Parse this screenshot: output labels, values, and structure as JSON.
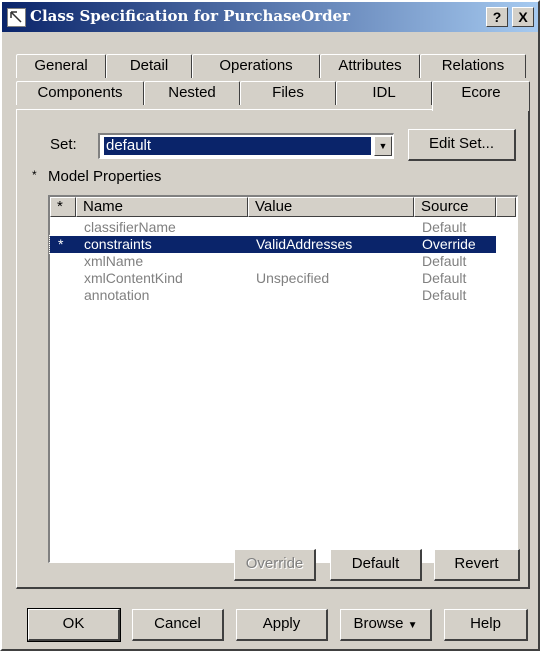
{
  "window": {
    "title": "Class Specification for PurchaseOrder",
    "help_btn": "?",
    "close_btn": "X"
  },
  "tabs": {
    "row_back": [
      "General",
      "Detail",
      "Operations",
      "Attributes",
      "Relations"
    ],
    "row_front": [
      "Components",
      "Nested",
      "Files",
      "IDL",
      "Ecore"
    ],
    "active": "Ecore"
  },
  "set": {
    "label": "Set:",
    "value": "default",
    "edit_button": "Edit Set..."
  },
  "model_properties": {
    "marker": "*",
    "label": "Model Properties",
    "columns": {
      "marker": "*",
      "name": "Name",
      "value": "Value",
      "source": "Source"
    },
    "rows": [
      {
        "marker": "",
        "name": "classifierName",
        "value": "",
        "source": "Default"
      },
      {
        "marker": "*",
        "name": "constraints",
        "value": "ValidAddresses",
        "source": "Override"
      },
      {
        "marker": "",
        "name": "xmlName",
        "value": "",
        "source": "Default"
      },
      {
        "marker": "",
        "name": "xmlContentKind",
        "value": "Unspecified",
        "source": "Default"
      },
      {
        "marker": "",
        "name": "annotation",
        "value": "",
        "source": "Default"
      }
    ]
  },
  "panel_buttons": {
    "override": "Override",
    "default": "Default",
    "revert": "Revert"
  },
  "footer": {
    "ok": "OK",
    "cancel": "Cancel",
    "apply": "Apply",
    "browse": "Browse",
    "help": "Help"
  },
  "colors": {
    "selection": "#0a246a",
    "face": "#d4d0c8",
    "title_start": "#0a246a"
  }
}
